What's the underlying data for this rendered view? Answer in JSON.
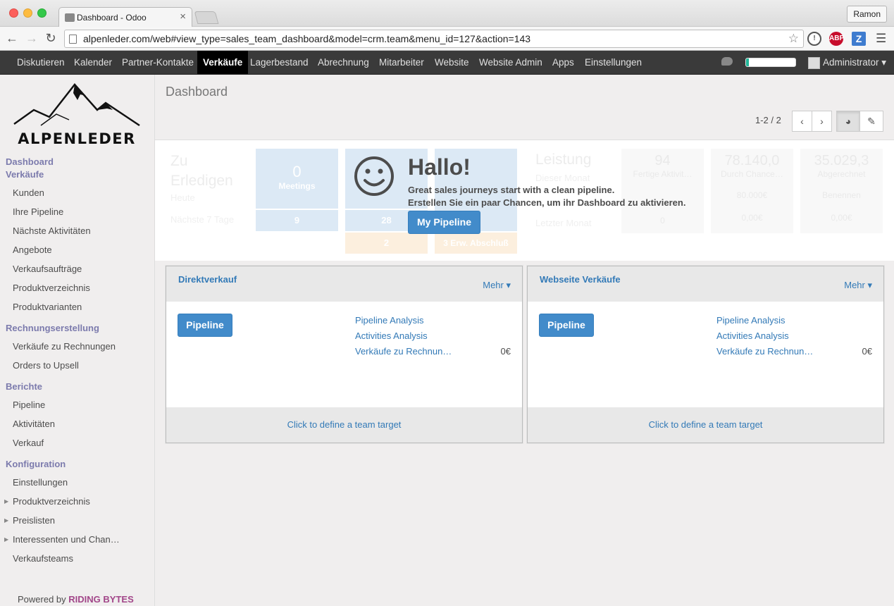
{
  "browser": {
    "tab_title": "Dashboard - Odoo",
    "profile": "Ramon",
    "url": "alpenleder.com/web#view_type=sales_team_dashboard&model=crm.team&menu_id=127&action=143",
    "ext_abp": "ABP",
    "ext_z": "Z"
  },
  "topmenu": {
    "items": [
      "Diskutieren",
      "Kalender",
      "Partner-Kontakte",
      "Verkäufe",
      "Lagerbestand",
      "Abrechnung",
      "Mitarbeiter",
      "Website",
      "Website Admin",
      "Apps",
      "Einstellungen"
    ],
    "active": "Verkäufe",
    "progress": 0.06,
    "user": "Administrator ▾"
  },
  "sidebar": {
    "logo_text": "ALPENLEDER",
    "sections": [
      {
        "title": "Dashboard",
        "items": []
      },
      {
        "title": "Verkäufe",
        "items": [
          "Kunden",
          "Ihre Pipeline",
          "Nächste Aktivitäten",
          "Angebote",
          "Verkaufsaufträge",
          "Produktverzeichnis",
          "Produktvarianten"
        ]
      },
      {
        "title": "Rechnungserstellung",
        "items": [
          "Verkäufe zu Rechnungen",
          "Orders to Upsell"
        ]
      },
      {
        "title": "Berichte",
        "items": [
          "Pipeline",
          "Aktivitäten",
          "Verkauf"
        ]
      },
      {
        "title": "Konfiguration",
        "items": [
          "Einstellungen",
          "Produktverzeichnis",
          "Preislisten",
          "Interessenten und Chan…",
          "Verkaufsteams"
        ]
      }
    ],
    "powered_prefix": "Powered by",
    "powered_brand": "RIDING BYTES"
  },
  "control": {
    "breadcrumb": "Dashboard",
    "pager": "1-2 / 2"
  },
  "background": {
    "todo_title": "Zu Erledigen",
    "todo_today": "Heute",
    "todo_next": "Nächste 7 Tage",
    "meetings_value": "0",
    "meetings_label": "Meetings",
    "meetings_next": "9",
    "calls_next": "28",
    "overdue_value": "2",
    "overdue_label": "3 Erw. Abschluß",
    "perf_title": "Leistung",
    "perf_month": "Dieser Monat",
    "perf_last": "Letzter Monat",
    "col1_value": "94",
    "col1_label": "Fertige Aktivit…",
    "col1_last": "0",
    "col2_value": "78.140,0",
    "col2_label": "Durch Chance…",
    "col2_target": "80.000€",
    "col2_last": "0,00€",
    "col3_value": "35.029,3",
    "col3_label": "Abgerechnet",
    "col3_target": "Benennen",
    "col3_last": "0,00€"
  },
  "hallo": {
    "title": "Hallo!",
    "line1": "Great sales journeys start with a clean pipeline.",
    "line2": "Erstellen Sie ein paar Chancen, um ihr Dashboard zu aktivieren.",
    "button": "My Pipeline"
  },
  "teams": [
    {
      "name": "Direktverkauf",
      "more": "Mehr ▾",
      "pipeline_btn": "Pipeline",
      "links": [
        "Pipeline Analysis",
        "Activities Analysis",
        "Verkäufe zu Rechnun…"
      ],
      "amount": "0€",
      "footer": "Click to define a team target"
    },
    {
      "name": "Webseite Verkäufe",
      "more": "Mehr ▾",
      "pipeline_btn": "Pipeline",
      "links": [
        "Pipeline Analysis",
        "Activities Analysis",
        "Verkäufe zu Rechnun…"
      ],
      "amount": "0€",
      "footer": "Click to define a team target"
    }
  ]
}
